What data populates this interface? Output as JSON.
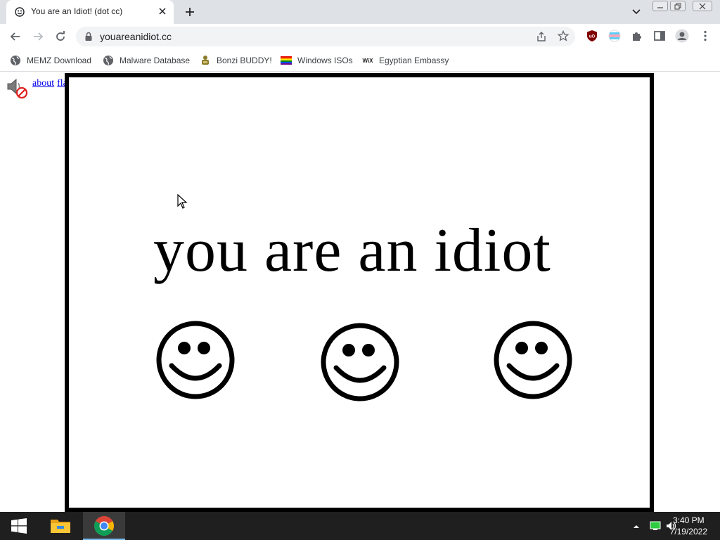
{
  "browser": {
    "tab": {
      "title": "You are an Idiot! (dot cc)",
      "favicon": "smiley-icon"
    },
    "address": {
      "url": "youareanidiot.cc"
    },
    "bookmarks": [
      {
        "label": "MEMZ Download",
        "icon": "globe-icon"
      },
      {
        "label": "Malware Database",
        "icon": "globe-icon"
      },
      {
        "label": "Bonzi BUDDY!",
        "icon": "bonzi-icon"
      },
      {
        "label": "Windows ISOs",
        "icon": "rainbow-flag-icon"
      },
      {
        "label": "Egyptian Embassy",
        "icon": "wix-icon"
      }
    ],
    "extensions": [
      "ublock-icon",
      "flag-icon",
      "puzzle-icon",
      "sidepanel-icon",
      "profile-icon",
      "menu-icon"
    ]
  },
  "page": {
    "links": {
      "about": "about",
      "flash": "flash"
    },
    "headline": "you are an idiot",
    "smiley_count": 3
  },
  "taskbar": {
    "items": [
      "start-icon",
      "file-explorer-icon",
      "chrome-icon"
    ],
    "clock": {
      "time": "3:40 PM",
      "date": "7/19/2022"
    }
  },
  "colors": {
    "tabstrip": "#dee1e6",
    "link": "#0000ee",
    "frame": "#000000",
    "taskbar": "#1f1f1f"
  }
}
